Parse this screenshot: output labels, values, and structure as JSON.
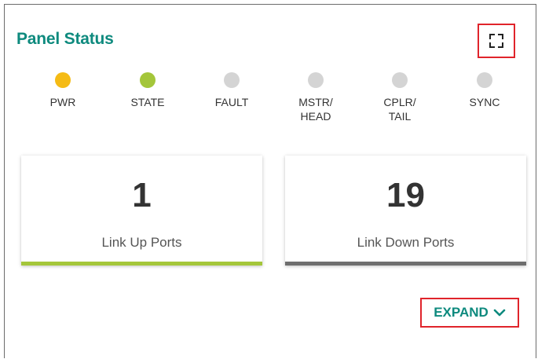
{
  "panel": {
    "title": "Panel Status",
    "fullscreen_icon": "fullscreen-icon",
    "accent_color": "#0e8a7e"
  },
  "leds": [
    {
      "label": "PWR",
      "color": "#f5bb15"
    },
    {
      "label": "STATE",
      "color": "#a4c63a"
    },
    {
      "label": "FAULT",
      "color": "#d4d4d4"
    },
    {
      "label": "MSTR/\nHEAD",
      "color": "#d4d4d4"
    },
    {
      "label": "CPLR/\nTAIL",
      "color": "#d4d4d4"
    },
    {
      "label": "SYNC",
      "color": "#d4d4d4"
    }
  ],
  "cards": [
    {
      "value": "1",
      "caption": "Link Up Ports",
      "bar_color": "#a4c63a"
    },
    {
      "value": "19",
      "caption": "Link Down Ports",
      "bar_color": "#6e6e6e"
    }
  ],
  "expand": {
    "label": "EXPAND",
    "icon": "chevron-down-icon"
  }
}
